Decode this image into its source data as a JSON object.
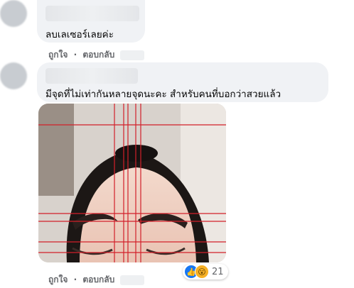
{
  "comment1": {
    "text": "ลบเลเซอร์เลยค่ะ",
    "actions": {
      "like": "ถูกใจ",
      "sep": "·",
      "reply": "ตอบกลับ"
    }
  },
  "comment2": {
    "text": "มีจุดที่ไม่เท่ากันหลายจุดนะคะ สำหรับคนที่บอกว่าสวยแล้ว",
    "actions": {
      "like": "ถูกใจ",
      "sep": "·",
      "reply": "ตอบกลับ"
    },
    "reactions": {
      "icons": [
        "like-icon",
        "wow-icon"
      ],
      "count": "21"
    }
  },
  "colors": {
    "bubble": "#f0f2f5",
    "action_text": "#65676b",
    "guide_lines": "#d2202a",
    "like_blue": "#1877f2"
  }
}
